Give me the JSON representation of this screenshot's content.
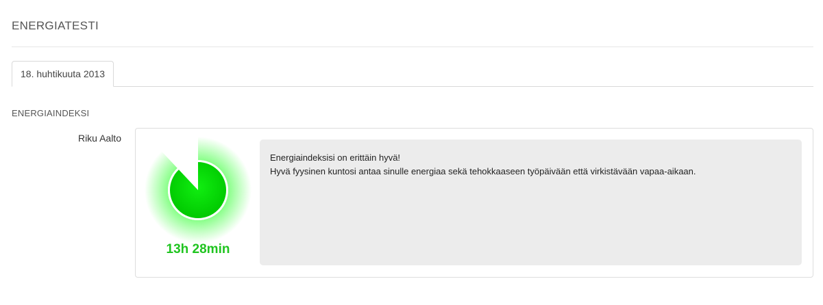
{
  "page": {
    "title": "ENERGIATESTI"
  },
  "tabs": [
    {
      "label": "18. huhtikuuta 2013",
      "active": true
    }
  ],
  "section": {
    "title": "ENERGIAINDEKSI"
  },
  "result": {
    "person_name": "Riku Aalto",
    "gauge": {
      "fill_fraction": 0.88,
      "fill_color": "#00dd00",
      "glow_color": "#22ff22",
      "track_color": "#ffffff"
    },
    "time_label": "13h 28min",
    "time_color": "#1fc41f",
    "message": {
      "line1": "Energiaindeksisi on erittäin hyvä!",
      "line2": "Hyvä fyysinen kuntosi antaa sinulle energiaa sekä tehokkaaseen työpäivään että virkistävään vapaa-aikaan."
    }
  }
}
